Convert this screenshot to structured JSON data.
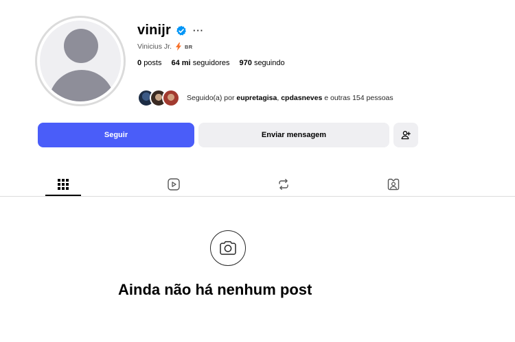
{
  "profile": {
    "username": "vinijr",
    "full_name": "Vinicius Jr.",
    "country_code": "BR",
    "posts_count": "0",
    "posts_label": "posts",
    "followers_count": "64 mi",
    "followers_label": "seguidores",
    "following_count": "970",
    "following_label": "seguindo",
    "more_label": "···"
  },
  "followed_by": {
    "prefix": "Seguido(a) por ",
    "user1": "eupretagisa",
    "separator": ", ",
    "user2": "cpdasneves",
    "suffix": " e outras 154 pessoas"
  },
  "buttons": {
    "follow_label": "Seguir",
    "message_label": "Enviar mensagem"
  },
  "tabs": [
    {
      "name": "posts",
      "icon": "grid-icon",
      "active": true
    },
    {
      "name": "reels",
      "icon": "reels-icon",
      "active": false
    },
    {
      "name": "reposts",
      "icon": "repost-icon",
      "active": false
    },
    {
      "name": "tagged",
      "icon": "tagged-icon",
      "active": false
    }
  ],
  "empty_state": {
    "title": "Ainda não há nenhum post",
    "icon": "camera-icon"
  },
  "colors": {
    "accent": "#4a5df9",
    "secondary_button": "#efeff2",
    "verified_badge": "#0095f6",
    "bolt": "#f7722b"
  }
}
